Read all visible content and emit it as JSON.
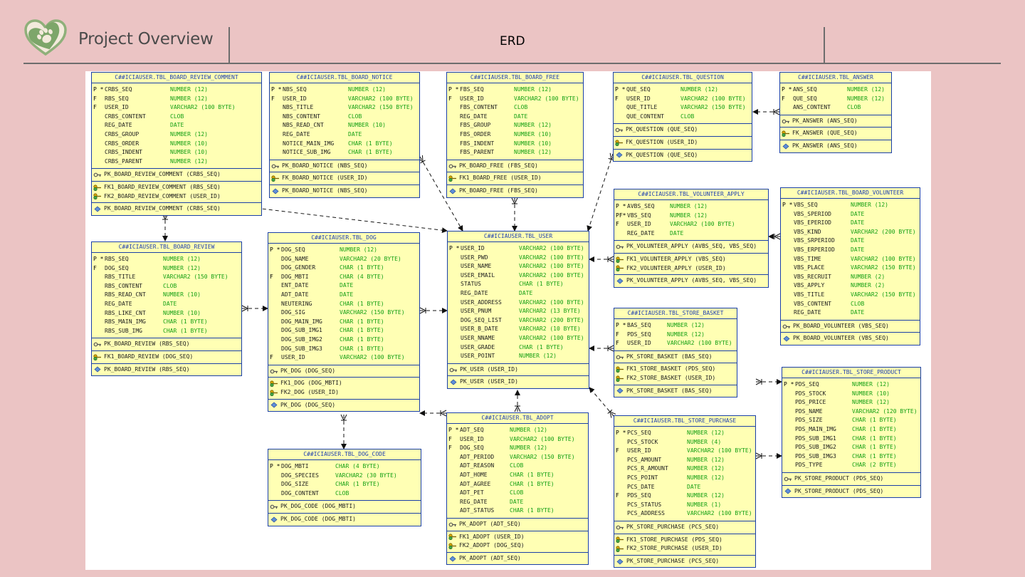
{
  "header": {
    "title": "Project Overview",
    "center_label": "ERD"
  },
  "colors": {
    "background": "#ebc4c4",
    "table_fill": "#ffffb4",
    "table_border": "#1a3fa8",
    "type_text": "#14a014",
    "header_text": "#1f3fb0"
  },
  "tables": [
    {
      "id": "t_rc",
      "name": "C##ICIAUSER.TBL_BOARD_REVIEW_COMMENT",
      "cols": [
        [
          "P *",
          "CRBS_SEQ",
          "NUMBER (12)"
        ],
        [
          "F",
          "RBS_SEQ",
          "NUMBER (12)"
        ],
        [
          "F",
          "USER_ID",
          "VARCHAR2 (100 BYTE)"
        ],
        [
          "",
          "CRBS_CONTENT",
          "CLOB"
        ],
        [
          "",
          "REG_DATE",
          "DATE"
        ],
        [
          "",
          "CRBS_GROUP",
          "NUMBER (12)"
        ],
        [
          "",
          "CRBS_ORDER",
          "NUMBER (10)"
        ],
        [
          "",
          "CRBS_INDENT",
          "NUMBER (10)"
        ],
        [
          "",
          "CRBS_PARENT",
          "NUMBER (12)"
        ]
      ],
      "pk": [
        "PK_BOARD_REVIEW_COMMENT (CRBS_SEQ)"
      ],
      "fk": [
        "FK1_BOARD_REVIEW_COMMENT (RBS_SEQ)",
        "FK2_BOARD_REVIEW_COMMENT (USER_ID)"
      ],
      "idx": [
        "PK_BOARD_REVIEW_COMMENT (CRBS_SEQ)"
      ]
    },
    {
      "id": "t_notice",
      "name": "C##ICIAUSER.TBL_BOARD_NOTICE",
      "cols": [
        [
          "P *",
          "NBS_SEQ",
          "NUMBER (12)"
        ],
        [
          "F",
          "USER_ID",
          "VARCHAR2 (100 BYTE)"
        ],
        [
          "",
          "NBS_TITLE",
          "VARCHAR2 (150 BYTE)"
        ],
        [
          "",
          "NBS_CONTENT",
          "CLOB"
        ],
        [
          "",
          "NBS_READ_CNT",
          "NUMBER (10)"
        ],
        [
          "",
          "REG_DATE",
          "DATE"
        ],
        [
          "",
          "NOTICE_MAIN_IMG",
          "CHAR (1 BYTE)"
        ],
        [
          "",
          "NOTICE_SUB_IMG",
          "CHAR (1 BYTE)"
        ]
      ],
      "pk": [
        "PK_BOARD_NOTICE (NBS_SEQ)"
      ],
      "fk": [
        "FK_BOARD_NOTICE (USER_ID)"
      ],
      "idx": [
        "PK_BOARD_NOTICE (NBS_SEQ)"
      ]
    },
    {
      "id": "t_free",
      "name": "C##ICIAUSER.TBL_BOARD_FREE",
      "cols": [
        [
          "P *",
          "FBS_SEQ",
          "NUMBER (12)"
        ],
        [
          "F",
          "USER_ID",
          "VARCHAR2 (100 BYTE)"
        ],
        [
          "",
          "FBS_CONTENT",
          "CLOB"
        ],
        [
          "",
          "REG_DATE",
          "DATE"
        ],
        [
          "",
          "FBS_GROUP",
          "NUMBER (12)"
        ],
        [
          "",
          "FBS_ORDER",
          "NUMBER (10)"
        ],
        [
          "",
          "FBS_INDENT",
          "NUMBER (10)"
        ],
        [
          "",
          "FBS_PARENT",
          "NUMBER (12)"
        ]
      ],
      "pk": [
        "PK_BOARD_FREE (FBS_SEQ)"
      ],
      "fk": [
        "FK1_BOARD_FREE (USER_ID)"
      ],
      "idx": [
        "PK_BOARD_FREE (FBS_SEQ)"
      ]
    },
    {
      "id": "t_question",
      "name": "C##ICIAUSER.TBL_QUESTION",
      "cols": [
        [
          "P *",
          "QUE_SEQ",
          "NUMBER (12)"
        ],
        [
          "F",
          "USER_ID",
          "VARCHAR2 (100 BYTE)"
        ],
        [
          "",
          "QUE_TITLE",
          "VARCHAR2 (150 BYTE)"
        ],
        [
          "",
          "QUE_CONTENT",
          "CLOB"
        ]
      ],
      "pk": [
        "PK_QUESTION (QUE_SEQ)"
      ],
      "fk": [
        "FK_QUESTION (USER_ID)"
      ],
      "idx": [
        "PK_QUESTION (QUE_SEQ)"
      ]
    },
    {
      "id": "t_answer",
      "name": "C##ICIAUSER.TBL_ANSWER",
      "cols": [
        [
          "P *",
          "ANS_SEQ",
          "NUMBER (12)"
        ],
        [
          "F",
          "QUE_SEQ",
          "NUMBER (12)"
        ],
        [
          "",
          "ANS_CONTENT",
          "CLOB"
        ]
      ],
      "pk": [
        "PK_ANSWER (ANS_SEQ)"
      ],
      "fk": [
        "FK_ANSWER (QUE_SEQ)"
      ],
      "idx": [
        "PK_ANSWER (ANS_SEQ)"
      ]
    },
    {
      "id": "t_vapply",
      "name": "C##ICIAUSER.TBL_VOLUNTEER_APPLY",
      "cols": [
        [
          "P *",
          "AVBS_SEQ",
          "NUMBER (12)"
        ],
        [
          "PF*",
          "VBS_SEQ",
          "NUMBER (12)"
        ],
        [
          "F",
          "USER_ID",
          "VARCHAR2 (100 BYTE)"
        ],
        [
          "",
          "REG_DATE",
          "DATE"
        ]
      ],
      "pk": [
        "PK_VOLUNTEER_APPLY (AVBS_SEQ, VBS_SEQ)"
      ],
      "fk": [
        "FK1_VOLUNTEER_APPLY (VBS_SEQ)",
        "FK2_VOLUNTEER_APPLY (USER_ID)"
      ],
      "idx": [
        "PK_VOLUNTEER_APPLY (AVBS_SEQ, VBS_SEQ)"
      ]
    },
    {
      "id": "t_volunteer",
      "name": "C##ICIAUSER.TBL_BOARD_VOLUNTEER",
      "cols": [
        [
          "P *",
          "VBS_SEQ",
          "NUMBER (12)"
        ],
        [
          "",
          "VBS_SPERIOD",
          "DATE"
        ],
        [
          "",
          "VBS_EPERIOD",
          "DATE"
        ],
        [
          "",
          "VBS_KIND",
          "VARCHAR2 (200 BYTE)"
        ],
        [
          "",
          "VBS_SRPERIOD",
          "DATE"
        ],
        [
          "",
          "VBS_ERPERIOD",
          "DATE"
        ],
        [
          "",
          "VBS_TIME",
          "VARCHAR2 (100 BYTE)"
        ],
        [
          "",
          "VBS_PLACE",
          "VARCHAR2 (150 BYTE)"
        ],
        [
          "",
          "VBS_RECRUIT",
          "NUMBER (2)"
        ],
        [
          "",
          "VBS_APPLY",
          "NUMBER (2)"
        ],
        [
          "",
          "VBS_TITLE",
          "VARCHAR2 (150 BYTE)"
        ],
        [
          "",
          "VBS_CONTENT",
          "CLOB"
        ],
        [
          "",
          "REG_DATE",
          "DATE"
        ]
      ],
      "pk": [
        "PK_BOARD_VOLUNTEER (VBS_SEQ)"
      ],
      "fk": [],
      "idx": [
        "PK_BOARD_VOLUNTEER (VBS_SEQ)"
      ]
    },
    {
      "id": "t_review",
      "name": "C##ICIAUSER.TBL_BOARD_REVIEW",
      "cols": [
        [
          "P *",
          "RBS_SEQ",
          "NUMBER (12)"
        ],
        [
          "F",
          "DOG_SEQ",
          "NUMBER (12)"
        ],
        [
          "",
          "RBS_TITLE",
          "VARCHAR2 (150 BYTE)"
        ],
        [
          "",
          "RBS_CONTENT",
          "CLOB"
        ],
        [
          "",
          "RBS_READ_CNT",
          "NUMBER (10)"
        ],
        [
          "",
          "REG_DATE",
          "DATE"
        ],
        [
          "",
          "RBS_LIKE_CNT",
          "NUMBER (10)"
        ],
        [
          "",
          "RBS_MAIN_IMG",
          "CHAR (1 BYTE)"
        ],
        [
          "",
          "RBS_SUB_IMG",
          "CHAR (1 BYTE)"
        ]
      ],
      "pk": [
        "PK_BOARD_REVIEW (RBS_SEQ)"
      ],
      "fk": [
        "FK1_BOARD_REVIEW (DOG_SEQ)"
      ],
      "idx": [
        "PK_BOARD_REVIEW (RBS_SEQ)"
      ]
    },
    {
      "id": "t_dog",
      "name": "C##ICIAUSER.TBL_DOG",
      "cols": [
        [
          "P *",
          "DOG_SEQ",
          "NUMBER (12)"
        ],
        [
          "",
          "DOG_NAME",
          "VARCHAR2 (20 BYTE)"
        ],
        [
          "",
          "DOG_GENDER",
          "CHAR (1 BYTE)"
        ],
        [
          "F",
          "DOG_MBTI",
          "CHAR (4 BYTE)"
        ],
        [
          "",
          "ENT_DATE",
          "DATE"
        ],
        [
          "",
          "ADT_DATE",
          "DATE"
        ],
        [
          "",
          "NEUTERING",
          "CHAR (1 BYTE)"
        ],
        [
          "",
          "DOG_SIG",
          "VARCHAR2 (150 BYTE)"
        ],
        [
          "",
          "DOG_MAIN_IMG",
          "CHAR (1 BYTE)"
        ],
        [
          "",
          "DOG_SUB_IMG1",
          "CHAR (1 BYTE)"
        ],
        [
          "",
          "DOG_SUB_IMG2",
          "CHAR (1 BYTE)"
        ],
        [
          "",
          "DOG_SUB_IMG3",
          "CHAR (1 BYTE)"
        ],
        [
          "F",
          "USER_ID",
          "VARCHAR2 (100 BYTE)"
        ]
      ],
      "pk": [
        "PK_DOG (DOG_SEQ)"
      ],
      "fk": [
        "FK1_DOG (DOG_MBTI)",
        "FK2_DOG (USER_ID)"
      ],
      "idx": [
        "PK_DOG (DOG_SEQ)"
      ]
    },
    {
      "id": "t_user",
      "name": "C##ICIAUSER.TBL_USER",
      "cols": [
        [
          "P *",
          "USER_ID",
          "VARCHAR2 (100 BYTE)"
        ],
        [
          "",
          "USER_PWD",
          "VARCHAR2 (100 BYTE)"
        ],
        [
          "",
          "USER_NAME",
          "VARCHAR2 (100 BYTE)"
        ],
        [
          "",
          "USER_EMAIL",
          "VARCHAR2 (100 BYTE)"
        ],
        [
          "",
          "STATUS",
          "CHAR (1 BYTE)"
        ],
        [
          "",
          "REG_DATE",
          "DATE"
        ],
        [
          "",
          "USER_ADDRESS",
          "VARCHAR2 (100 BYTE)"
        ],
        [
          "",
          "USER_PNUM",
          "VARCHAR2 (13 BYTE)"
        ],
        [
          "",
          "DOG_SEQ_LIST",
          "VARCHAR2 (200 BYTE)"
        ],
        [
          "",
          "USER_B_DATE",
          "VARCHAR2 (10 BYTE)"
        ],
        [
          "",
          "USER_NNAME",
          "VARCHAR2 (100 BYTE)"
        ],
        [
          "",
          "USER_GRADE",
          "CHAR (1 BYTE)"
        ],
        [
          "",
          "USER_POINT",
          "NUMBER (12)"
        ]
      ],
      "pk": [
        "PK_USER (USER_ID)"
      ],
      "fk": [],
      "idx": [
        "PK_USER (USER_ID)"
      ]
    },
    {
      "id": "t_basket",
      "name": "C##ICIAUSER.TBL_STORE_BASKET",
      "cols": [
        [
          "P *",
          "BAS_SEQ",
          "NUMBER (12)"
        ],
        [
          "F",
          "PDS_SEQ",
          "NUMBER (12)"
        ],
        [
          "F",
          "USER_ID",
          "VARCHAR2 (100 BYTE)"
        ]
      ],
      "pk": [
        "PK_STORE_BASKET (BAS_SEQ)"
      ],
      "fk": [
        "FK1_STORE_BASKET (PDS_SEQ)",
        "FK2_STORE_BASKET (USER_ID)"
      ],
      "idx": [
        "PK_STORE_BASKET (BAS_SEQ)"
      ]
    },
    {
      "id": "t_product",
      "name": "C##ICIAUSER.TBL_STORE_PRODUCT",
      "cols": [
        [
          "P *",
          "PDS_SEQ",
          "NUMBER (12)"
        ],
        [
          "",
          "PDS_STOCK",
          "NUMBER (10)"
        ],
        [
          "",
          "PDS_PRICE",
          "NUMBER (12)"
        ],
        [
          "",
          "PDS_NAME",
          "VARCHAR2 (120 BYTE)"
        ],
        [
          "",
          "PDS_SIZE",
          "CHAR (1 BYTE)"
        ],
        [
          "",
          "PDS_MAIN_IMG",
          "CHAR (1 BYTE)"
        ],
        [
          "",
          "PDS_SUB_IMG1",
          "CHAR (1 BYTE)"
        ],
        [
          "",
          "PDS_SUB_IMG2",
          "CHAR (1 BYTE)"
        ],
        [
          "",
          "PDS_SUB_IMG3",
          "CHAR (1 BYTE)"
        ],
        [
          "",
          "PDS_TYPE",
          "CHAR (2 BYTE)"
        ]
      ],
      "pk": [
        "PK_STORE_PRODUCT (PDS_SEQ)"
      ],
      "fk": [],
      "idx": [
        "PK_STORE_PRODUCT (PDS_SEQ)"
      ]
    },
    {
      "id": "t_dogcode",
      "name": "C##ICIAUSER.TBL_DOG_CODE",
      "cols": [
        [
          "P *",
          "DOG_MBTI",
          "CHAR (4 BYTE)"
        ],
        [
          "",
          "DOG_SPECIES",
          "VARCHAR2 (30 BYTE)"
        ],
        [
          "",
          "DOG_SIZE",
          "CHAR (1 BYTE)"
        ],
        [
          "",
          "DOG_CONTENT",
          "CLOB"
        ]
      ],
      "pk": [
        "PK_DOG_CODE (DOG_MBTI)"
      ],
      "fk": [],
      "idx": [
        "PK_DOG_CODE (DOG_MBTI)"
      ]
    },
    {
      "id": "t_adopt",
      "name": "C##ICIAUSER.TBL_ADOPT",
      "cols": [
        [
          "P *",
          "ADT_SEQ",
          "NUMBER (12)"
        ],
        [
          "F",
          "USER_ID",
          "VARCHAR2 (100 BYTE)"
        ],
        [
          "F",
          "DOG_SEQ",
          "NUMBER (12)"
        ],
        [
          "",
          "ADT_PERIOD",
          "VARCHAR2 (150 BYTE)"
        ],
        [
          "",
          "ADT_REASON",
          "CLOB"
        ],
        [
          "",
          "ADT_HOME",
          "CHAR (1 BYTE)"
        ],
        [
          "",
          "ADT_AGREE",
          "CHAR (1 BYTE)"
        ],
        [
          "",
          "ADT_PET",
          "CLOB"
        ],
        [
          "",
          "REG_DATE",
          "DATE"
        ],
        [
          "",
          "ADT_STATUS",
          "CHAR (1 BYTE)"
        ]
      ],
      "pk": [
        "PK_ADOPT (ADT_SEQ)"
      ],
      "fk": [
        "FK1_ADOPT (USER_ID)",
        "FK2_ADOPT (DOG_SEQ)"
      ],
      "idx": [
        "PK_ADOPT (ADT_SEQ)"
      ]
    },
    {
      "id": "t_purchase",
      "name": "C##ICIAUSER.TBL_STORE_PURCHASE",
      "cols": [
        [
          "P *",
          "PCS_SEQ",
          "NUMBER (12)"
        ],
        [
          "",
          "PCS_STOCK",
          "NUMBER (4)"
        ],
        [
          "F",
          "USER_ID",
          "VARCHAR2 (100 BYTE)"
        ],
        [
          "",
          "PCS_AMOUNT",
          "NUMBER (12)"
        ],
        [
          "",
          "PCS_R_AMOUNT",
          "NUMBER (12)"
        ],
        [
          "",
          "PCS_POINT",
          "NUMBER (12)"
        ],
        [
          "",
          "PCS_DATE",
          "DATE"
        ],
        [
          "F",
          "PDS_SEQ",
          "NUMBER (12)"
        ],
        [
          "",
          "PCS_STATUS",
          "NUMBER (1)"
        ],
        [
          "",
          "PCS_ADDRESS",
          "VARCHAR2 (100 BYTE)"
        ]
      ],
      "pk": [
        "PK_STORE_PURCHASE (PCS_SEQ)"
      ],
      "fk": [
        "FK1_STORE_PURCHASE (PDS_SEQ)",
        "FK2_STORE_PURCHASE (USER_ID)"
      ],
      "idx": [
        "PK_STORE_PURCHASE (PCS_SEQ)"
      ]
    }
  ]
}
